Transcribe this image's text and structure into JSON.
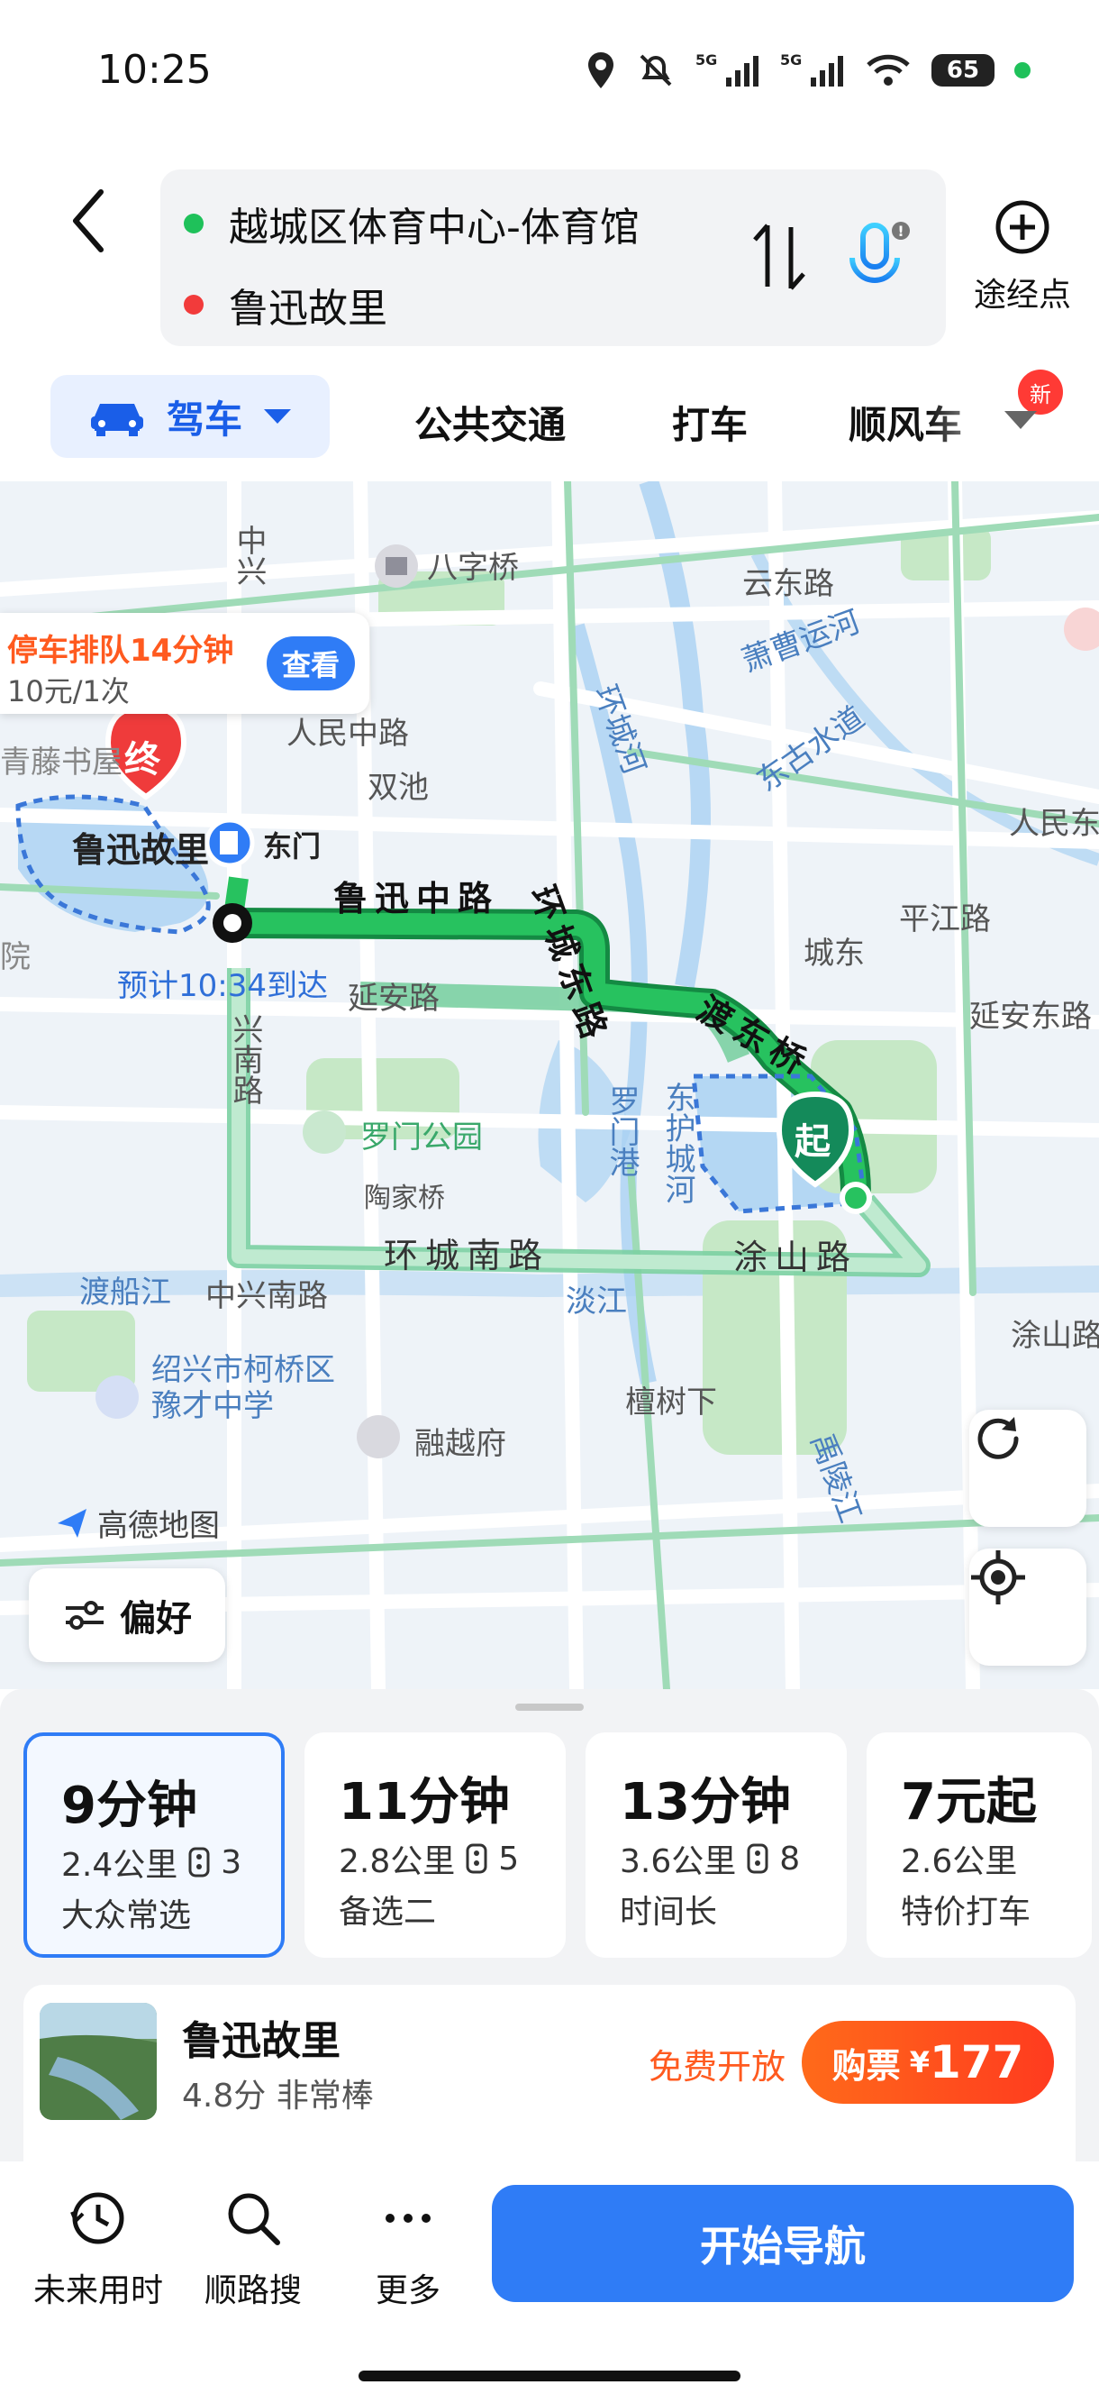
{
  "status": {
    "time": "10:25",
    "battery": "65",
    "net1": "5G",
    "net2": "5G"
  },
  "route": {
    "origin": "越城区体育中心-体育馆",
    "destination": "鲁迅故里",
    "waypoint_label": "途经点"
  },
  "tabs": {
    "drive": "驾车",
    "transit": "公共交通",
    "taxi": "打车",
    "carpool": "顺风车",
    "new_badge": "新"
  },
  "map": {
    "parking": {
      "title": "停车排队14分钟",
      "price": "10元/1次",
      "button": "查看"
    },
    "eta": "预计10:34到达",
    "end_marker": "终",
    "start_marker": "起",
    "dest_label": "鲁迅故里",
    "east_gate": "东门",
    "route_roads": [
      "鲁迅中路",
      "环城东路",
      "渡东桥"
    ],
    "labels": {
      "bazi": "八字桥",
      "yundong": "云东路",
      "xiaocao": "萧曹运河",
      "huancheng": "环城河",
      "donggu": "东古水道",
      "renmin_zhong": "人民中路",
      "shuangchi": "双池",
      "qingteng": "青藤书屋",
      "renmin_dong": "人民东",
      "pingjiang": "平江路",
      "chengdong": "城东",
      "yanan": "延安路",
      "yanan_dong": "延安东路",
      "yuan": "院",
      "zhongxing": "中兴",
      "xingnan": "兴南路",
      "luomen_park": "罗门公园",
      "taojia": "陶家桥",
      "luomen_gang": "罗门港",
      "donghu": "东护城河",
      "huancheng_nan": "环城南路",
      "tushan": "涂山路",
      "tushan2": "涂山路",
      "duchuan": "渡船江",
      "zhongxing_nan": "中兴南路",
      "dan": "淡江",
      "school": "绍兴市柯桥区豫才中学",
      "rongyue": "融越府",
      "tanshu": "檀树下",
      "yuling": "禹陵江",
      "amap": "高德地图"
    },
    "preference": "偏好"
  },
  "options": [
    {
      "time": "9分钟",
      "distance": "2.4公里",
      "lights": "3",
      "tag": "大众常选",
      "selected": true
    },
    {
      "time": "11分钟",
      "distance": "2.8公里",
      "lights": "5",
      "tag": "备选二",
      "selected": false
    },
    {
      "time": "13分钟",
      "distance": "3.6公里",
      "lights": "8",
      "tag": "时间长",
      "selected": false
    },
    {
      "time": "7元起",
      "distance": "2.6公里",
      "lights": "",
      "tag": "特价打车",
      "selected": false
    }
  ],
  "poi": {
    "name": "鲁迅故里",
    "rating": "4.8分 非常棒",
    "free": "免费开放",
    "buy_label": "购票",
    "currency": "¥",
    "price": "177"
  },
  "bottom": {
    "future": "未来用时",
    "along": "顺路搜",
    "more": "更多",
    "start": "开始导航"
  },
  "colors": {
    "accent": "#2f7cf6",
    "route": "#1fb457",
    "orange": "#ff5a1f"
  }
}
